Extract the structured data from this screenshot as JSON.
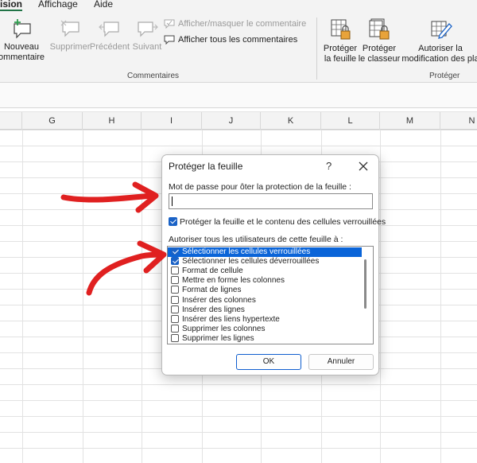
{
  "ribbon": {
    "tabs": [
      {
        "label": "ision"
      },
      {
        "label": "Affichage"
      },
      {
        "label": "Aide"
      }
    ],
    "comments_group": {
      "label": "Commentaires",
      "new_comment": [
        "Nouveau",
        "ommentaire"
      ],
      "delete": "Supprimer",
      "previous": "Précédent",
      "next": "Suivant",
      "show_hide": "Afficher/masquer le commentaire",
      "show_all": "Afficher tous les commentaires"
    },
    "protect_group": {
      "label": "Protéger",
      "protect_sheet": [
        "Protéger",
        "la feuille"
      ],
      "protect_workbook": [
        "Protéger",
        "le classeur"
      ],
      "allow_edit": [
        "Autoriser la",
        "modification des pla"
      ]
    }
  },
  "columns": [
    "G",
    "H",
    "I",
    "J",
    "K",
    "L",
    "M",
    "N"
  ],
  "dialog": {
    "title": "Protéger la feuille",
    "help": "?",
    "password_label": "Mot de passe pour ôter la protection de la feuille :",
    "password_value": "",
    "protect_checkbox_label": "Protéger la feuille et le contenu des cellules verrouillées",
    "protect_checked": true,
    "allow_label": "Autoriser tous les utilisateurs de cette feuille à :",
    "options": [
      {
        "label": "Sélectionner les cellules verrouillées",
        "checked": true,
        "selected": true
      },
      {
        "label": "Sélectionner les cellules déverrouillées",
        "checked": true,
        "selected": false
      },
      {
        "label": "Format de cellule",
        "checked": false,
        "selected": false
      },
      {
        "label": "Mettre en forme les colonnes",
        "checked": false,
        "selected": false
      },
      {
        "label": "Format de lignes",
        "checked": false,
        "selected": false
      },
      {
        "label": "Insérer des colonnes",
        "checked": false,
        "selected": false
      },
      {
        "label": "Insérer des lignes",
        "checked": false,
        "selected": false
      },
      {
        "label": "Insérer des liens hypertexte",
        "checked": false,
        "selected": false
      },
      {
        "label": "Supprimer les colonnes",
        "checked": false,
        "selected": false
      },
      {
        "label": "Supprimer les lignes",
        "checked": false,
        "selected": false
      }
    ],
    "ok": "OK",
    "cancel": "Annuler"
  },
  "colors": {
    "accent": "#1a62c6",
    "selection": "#0a64d8",
    "annotation": "#e02020"
  }
}
